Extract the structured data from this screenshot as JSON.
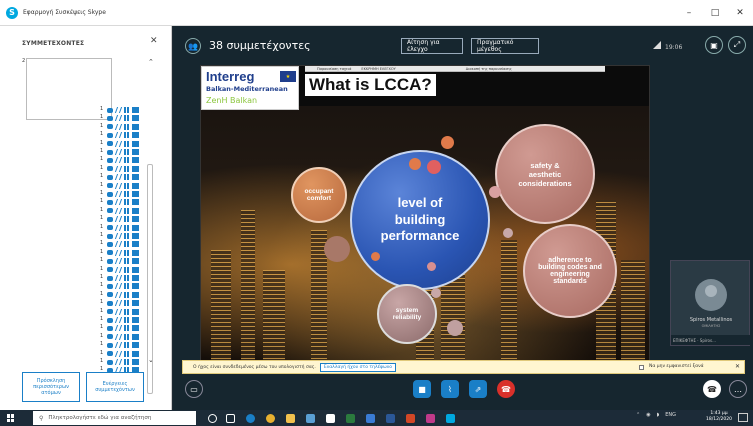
{
  "window": {
    "title": "Εφαρμογή Συσκέψεις Skype",
    "min": "–",
    "max": "□",
    "close": "✕"
  },
  "sidebar": {
    "header": "ΣΥΜΜΕΤΕΧΟΝΤΕΣ",
    "close": "✕",
    "first_index": "2",
    "participants_count_rows": 35,
    "invite_button": "Πρόσκληση περισσότερων ατόμων",
    "actions_button": "Ενέργειες συμμετεχόντων",
    "scroll_up": "⌃",
    "scroll_down": "⌄"
  },
  "meeting": {
    "people_icon": "👥",
    "participant_count": "38 συμμετέχοντες",
    "request_control": "Αίτηση για έλεγχο",
    "actual_size": "Πραγματικό μέγεθος",
    "signal": "19:06"
  },
  "slide": {
    "logo_main": "Interreg",
    "logo_sub": "Balkan-Mediterranean",
    "logo_project": "ZenH Balkan",
    "title": "What is LCCA?",
    "toolbar_left": "Παρουσίαση ταχειά",
    "toolbar_mid": "ΕΚΚΡΗΜΗ ΕΛΕΓΧΟΥ",
    "toolbar_right": "Διακοπή της παρουσίασης",
    "center": "level of building performance",
    "safety": "safety & aesthetic considerations",
    "adherence": "adherence to building codes and engineering standards",
    "comfort": "occupant comfort",
    "system": "system reliability"
  },
  "presenter_tile": {
    "name": "Spiros Metallinos",
    "role": "ΟΜΙΛΗΤΗΣ",
    "bar": "ΕΠΙΚΕΦΤΗΣ · Spiros..."
  },
  "notice": {
    "message": "Ο ήχος είναι συνδεδεμένος μέσω του υπολογιστή σας.",
    "action": "Εναλλαγή ήχου στο τηλέφωνο",
    "dont_show": "Να μην εμφανιστεί ξανά",
    "close": "✕"
  },
  "taskbar": {
    "search_placeholder": "Πληκτρολογήστε εδώ για αναζήτηση",
    "language": "ENG",
    "time": "1:43 μμ",
    "date": "18/12/2020"
  },
  "colors": {
    "accent": "#1a7fc7",
    "hangup": "#d9302a",
    "stage_bg": "#16262f",
    "center_bubble": "#2a55b3"
  }
}
